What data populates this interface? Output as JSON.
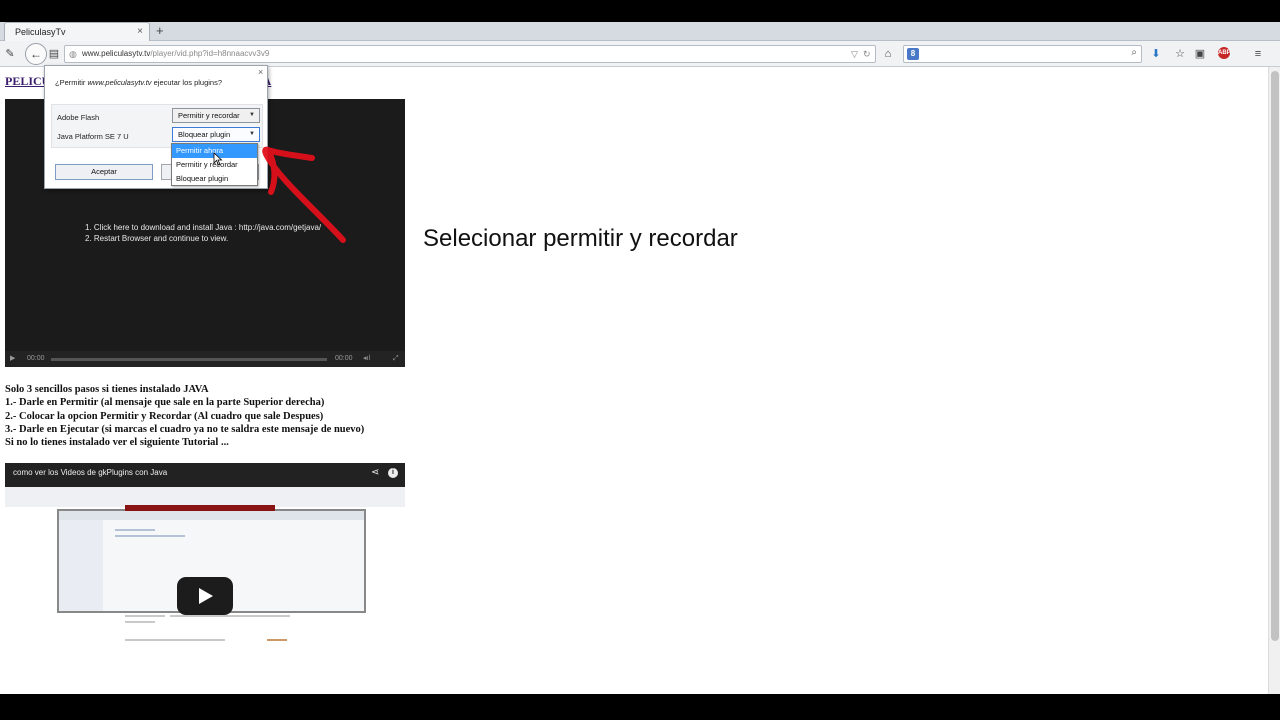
{
  "browser": {
    "tab_title": "PeliculasyTv",
    "tab_close": "×",
    "new_tab": "+",
    "url_host": "www.peliculasytv.tv",
    "url_path": "/player/vid.php?id=h8nnaacvv3v9",
    "search_engine_badge": "8",
    "addon_badge": "ABP"
  },
  "page": {
    "title_link": "PELICU",
    "title_link_end": "IA",
    "player": {
      "message": "1. Click here to download and install Java : http://java.com/getjava/\n2. Restart Browser and continue to view.",
      "time_current": "00:00",
      "time_total": "00:00"
    },
    "annotation": "Selecionar permitir y recordar",
    "steps": [
      "Solo 3 sencillos pasos si tienes instalado JAVA",
      "1.- Darle en Permitir (al mensaje que sale en la parte Superior derecha)",
      "2.- Colocar la opcion Permitir y Recordar (Al cuadro que sale Despues)",
      "3.- Darle en Ejecutar (si marcas el cuadro ya no te saldra este mensaje de nuevo)",
      "Si no lo tienes instalado ver el siguiente Tutorial ..."
    ],
    "video": {
      "title": "como ver los Videos de gkPlugins con Java"
    }
  },
  "dialog": {
    "question_prefix": "¿Permitir ",
    "question_site": "www.peliculasytv.tv",
    "question_suffix": " ejecutar los plugins?",
    "close": "×",
    "plugins": [
      {
        "name": "Adobe Flash",
        "value": "Permitir y recordar"
      },
      {
        "name": "Java Platform SE 7 U",
        "value": "Bloquear plugin"
      }
    ],
    "accept_label": "Aceptar",
    "dropdown_options": [
      "Permitir ahora",
      "Permitir y recordar",
      "Bloquear plugin"
    ],
    "dropdown_highlighted": "Permitir ahora"
  },
  "colors": {
    "link": "#3b1e6e",
    "highlight": "#3399ff",
    "arrow": "#e0101a"
  }
}
